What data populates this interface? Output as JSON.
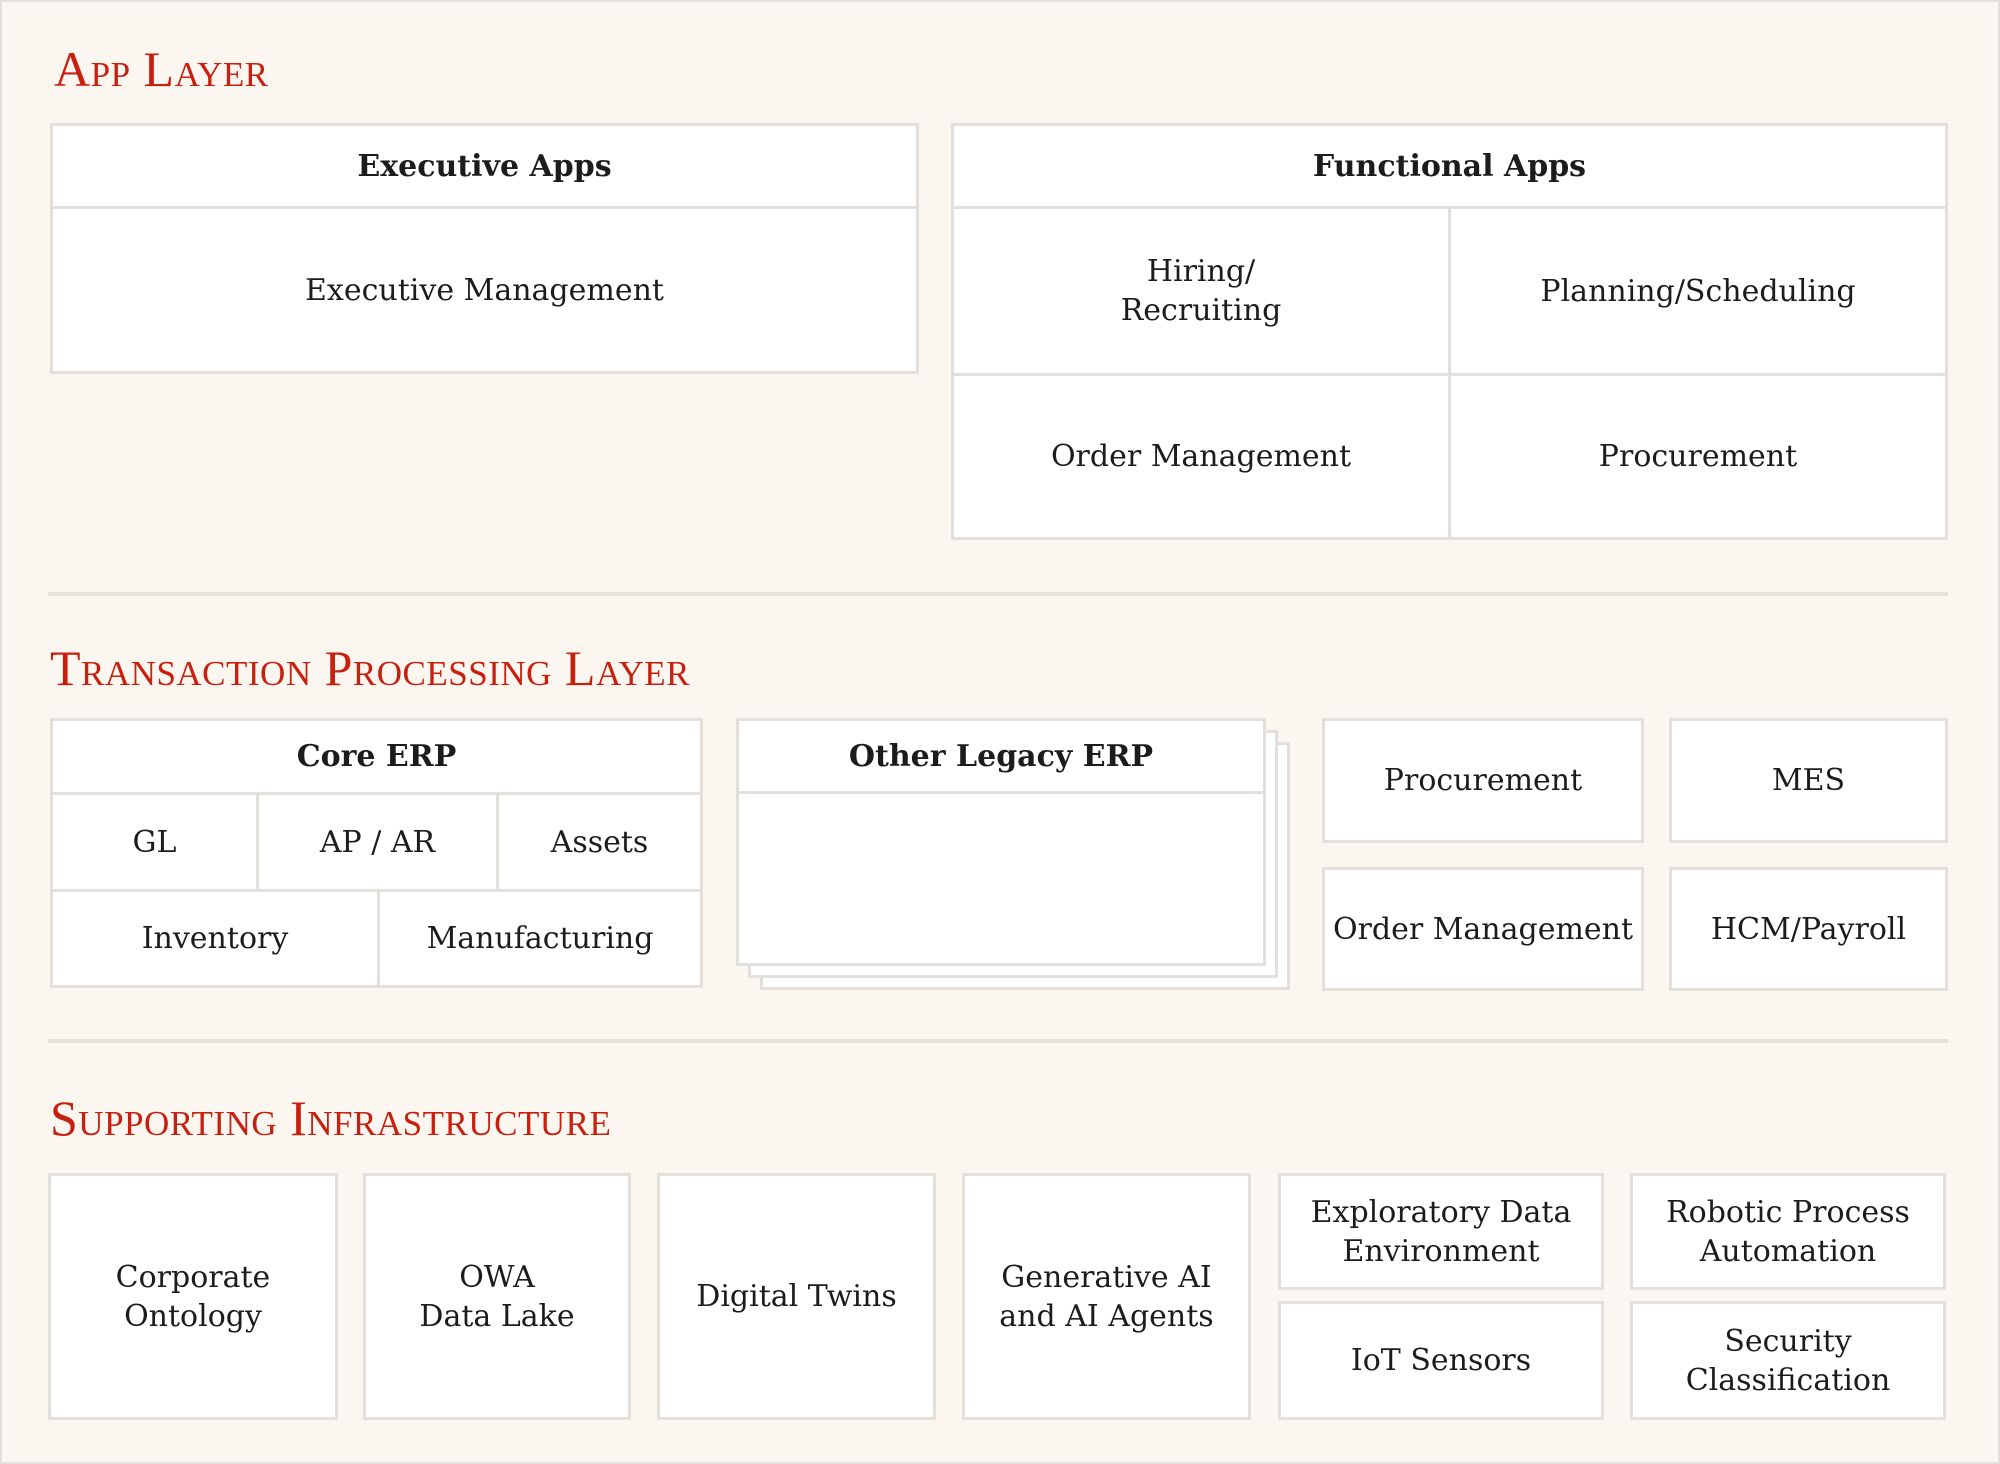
{
  "app_layer": {
    "heading": "App Layer",
    "executive": {
      "title": "Executive Apps",
      "items": [
        "Executive Management"
      ]
    },
    "functional": {
      "title": "Functional Apps",
      "items": [
        "Hiring/\nRecruiting",
        "Planning/Scheduling",
        "Order Management",
        "Procurement"
      ]
    }
  },
  "transaction_layer": {
    "heading": "Transaction Processing Layer",
    "core_erp": {
      "title": "Core ERP",
      "row1": [
        "GL",
        "AP / AR",
        "Assets"
      ],
      "row2": [
        "Inventory",
        "Manufacturing"
      ]
    },
    "legacy_erp": {
      "title": "Other Legacy ERP"
    },
    "systems": [
      "Procurement",
      "MES",
      "Order Management",
      "HCM/Payroll"
    ]
  },
  "infrastructure": {
    "heading": "Supporting Infrastructure",
    "items": [
      "Corporate\nOntology",
      "OWA\nData Lake",
      "Digital Twins",
      "Generative AI\nand AI Agents",
      "Exploratory Data\nEnvironment",
      "Robotic Process\nAutomation",
      "IoT Sensors",
      "Security\nClassification"
    ]
  }
}
